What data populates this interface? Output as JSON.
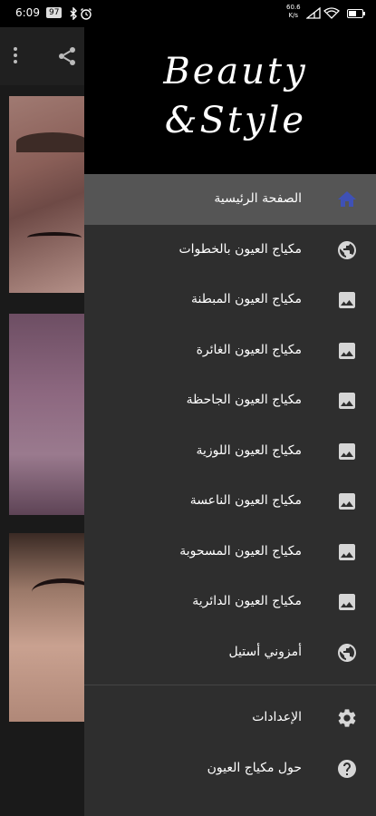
{
  "status_bar": {
    "time": "6:09",
    "badge": "97",
    "speed_line1": "60.6",
    "speed_line2": "K/s",
    "battery_level": 0.55
  },
  "app": {
    "more_icon": "more-vert-icon",
    "share_icon": "share-icon"
  },
  "drawer": {
    "logo_line1": "Beauty",
    "logo_line2": "&Style",
    "items": [
      {
        "label": "الصفحة الرئيسية",
        "icon": "home-icon",
        "active": true
      },
      {
        "label": "مكياج العيون بالخطوات",
        "icon": "globe-icon"
      },
      {
        "label": "مكياج العيون المبطنة",
        "icon": "image-icon"
      },
      {
        "label": "مكياج العيون الغائرة",
        "icon": "image-icon"
      },
      {
        "label": "مكياج العيون الجاحظة",
        "icon": "image-icon"
      },
      {
        "label": "مكياج العيون اللوزية",
        "icon": "image-icon"
      },
      {
        "label": "مكياج العيون الناعسة",
        "icon": "image-icon"
      },
      {
        "label": "مكياج العيون المسحوبة",
        "icon": "image-icon"
      },
      {
        "label": "مكياج العيون الدائرية",
        "icon": "image-icon"
      },
      {
        "label": "أمزوني أستيل",
        "icon": "globe-icon"
      }
    ],
    "secondary": [
      {
        "label": "الإعدادات",
        "icon": "settings-icon"
      },
      {
        "label": "حول مكياج العيون",
        "icon": "help-icon"
      }
    ]
  },
  "colors": {
    "active_icon": "#3f51b5",
    "icon": "#d6d6d6",
    "drawer_bg": "#2e2e2e",
    "active_bg": "#555555"
  }
}
